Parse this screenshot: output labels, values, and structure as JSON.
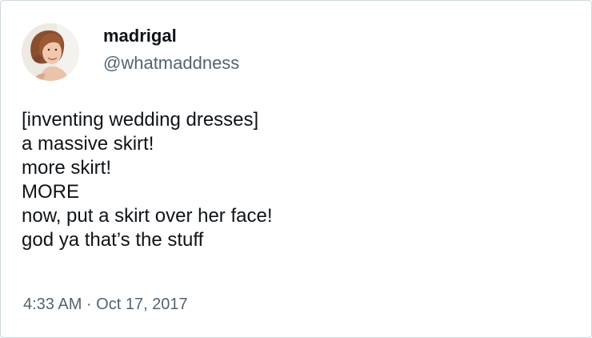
{
  "tweet": {
    "display_name": "madrigal",
    "handle": "@whatmaddness",
    "avatar_icon": "profile-photo",
    "lines": [
      "[inventing wedding dresses]",
      "a massive skirt!",
      "more skirt!",
      "MORE",
      "now, put a skirt over her face!",
      "god ya that’s the stuff"
    ],
    "timestamp": "4:33 AM · Oct 17, 2017"
  },
  "colors": {
    "text_primary": "#0f1419",
    "text_secondary": "#536471",
    "border": "#cfd9de"
  }
}
